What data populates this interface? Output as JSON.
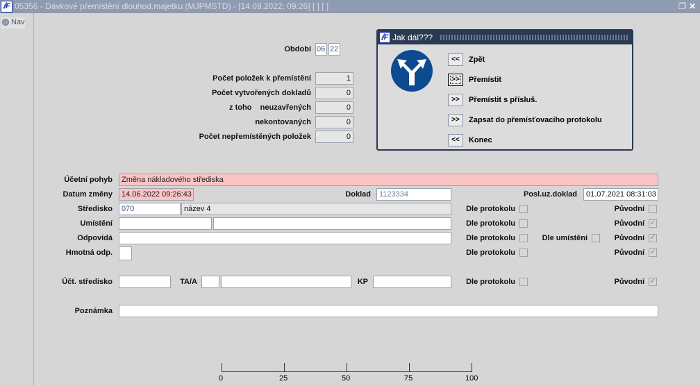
{
  "window": {
    "title": "05356 - Dávkové přemístění dlouhod.majetku (MJPMSTD) - [14.09.2022; 09:26]  [ ]  [ ]",
    "logo": "IF"
  },
  "nav": {
    "label": "Nav"
  },
  "top": {
    "obdobi_label": "Období",
    "obdobi_month": "06",
    "obdobi_year": "22",
    "rows": [
      {
        "label": "Počet položek k přemístění",
        "value": "1"
      },
      {
        "label": "Počet vytvořených dokladů",
        "value": "0"
      },
      {
        "label": "z toho    neuzavřených",
        "value": "0"
      },
      {
        "label": "nekontovaných",
        "value": "0"
      },
      {
        "label": "Počet nepřemístěných položek",
        "value": "0"
      }
    ]
  },
  "dialog": {
    "title": "Jak dál???",
    "logo": "IF",
    "buttons": [
      {
        "arrow": "<<",
        "label": "Zpět"
      },
      {
        "arrow": ">>",
        "label": "Přemístit"
      },
      {
        "arrow": ">>",
        "label": "Přemístit s přísluš."
      },
      {
        "arrow": ">>",
        "label": "Zapsat do přemísťovacího protokolu"
      },
      {
        "arrow": "<<",
        "label": "Konec"
      }
    ]
  },
  "form": {
    "ucetni_pohyb_label": "Účetní pohyb",
    "ucetni_pohyb": "Změna nákladového střediska",
    "datum_label": "Datum změny",
    "datum": "14.06.2022 09:26:43",
    "doklad_label": "Doklad",
    "doklad": "1123334",
    "posl_label": "Posl.uz.doklad",
    "posl": "01.07.2021 08:31:03",
    "stredisko_label": "Středisko",
    "stredisko": "070",
    "stredisko_nazev": "název 4",
    "umisteni_label": "Umístění",
    "odpovida_label": "Odpovídá",
    "hmotna_label": "Hmotná odp.",
    "uct_stredisko_label": "Účt. středisko",
    "taa_label": "TA/A",
    "kp_label": "KP",
    "poznamka_label": "Poznámka",
    "dle_protokolu": "Dle protokolu",
    "puvodni": "Původní",
    "dle_umisteni": "Dle umístění"
  },
  "scale": {
    "ticks": [
      "0",
      "25",
      "50",
      "75",
      "100"
    ]
  }
}
